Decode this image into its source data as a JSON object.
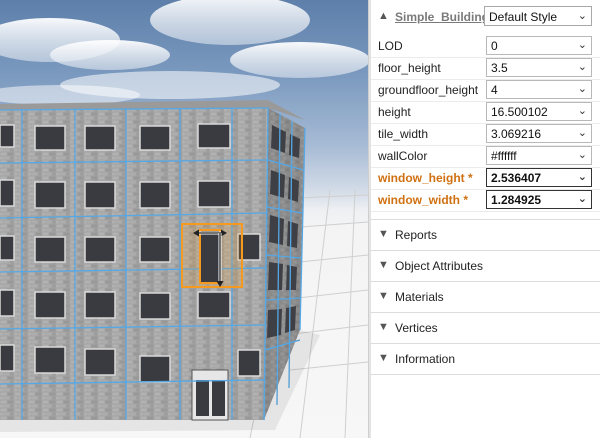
{
  "inspector": {
    "shape_link": "Simple_Building",
    "style_value": "Default Style",
    "attributes": [
      {
        "label": "LOD",
        "value": "0",
        "modified": false
      },
      {
        "label": "floor_height",
        "value": "3.5",
        "modified": false
      },
      {
        "label": "groundfloor_height",
        "value": "4",
        "modified": false
      },
      {
        "label": "height",
        "value": "16.500102",
        "modified": false
      },
      {
        "label": "tile_width",
        "value": "3.069216",
        "modified": false
      },
      {
        "label": "wallColor",
        "value": "#ffffff",
        "modified": false
      },
      {
        "label": "window_height *",
        "value": "2.536407",
        "modified": true
      },
      {
        "label": "window_width *",
        "value": "1.284925",
        "modified": true
      }
    ],
    "sections": [
      {
        "label": "Reports"
      },
      {
        "label": "Object Attributes"
      },
      {
        "label": "Materials"
      },
      {
        "label": "Vertices"
      },
      {
        "label": "Information"
      }
    ]
  },
  "colors": {
    "modified_label": "#d07010",
    "selection_highlight": "#f59a1e",
    "grid_lines": "#55a8e6"
  },
  "icons": {
    "collapse": "caret-up-icon",
    "expand": "caret-down-icon",
    "dropdown": "chevron-down-icon"
  }
}
